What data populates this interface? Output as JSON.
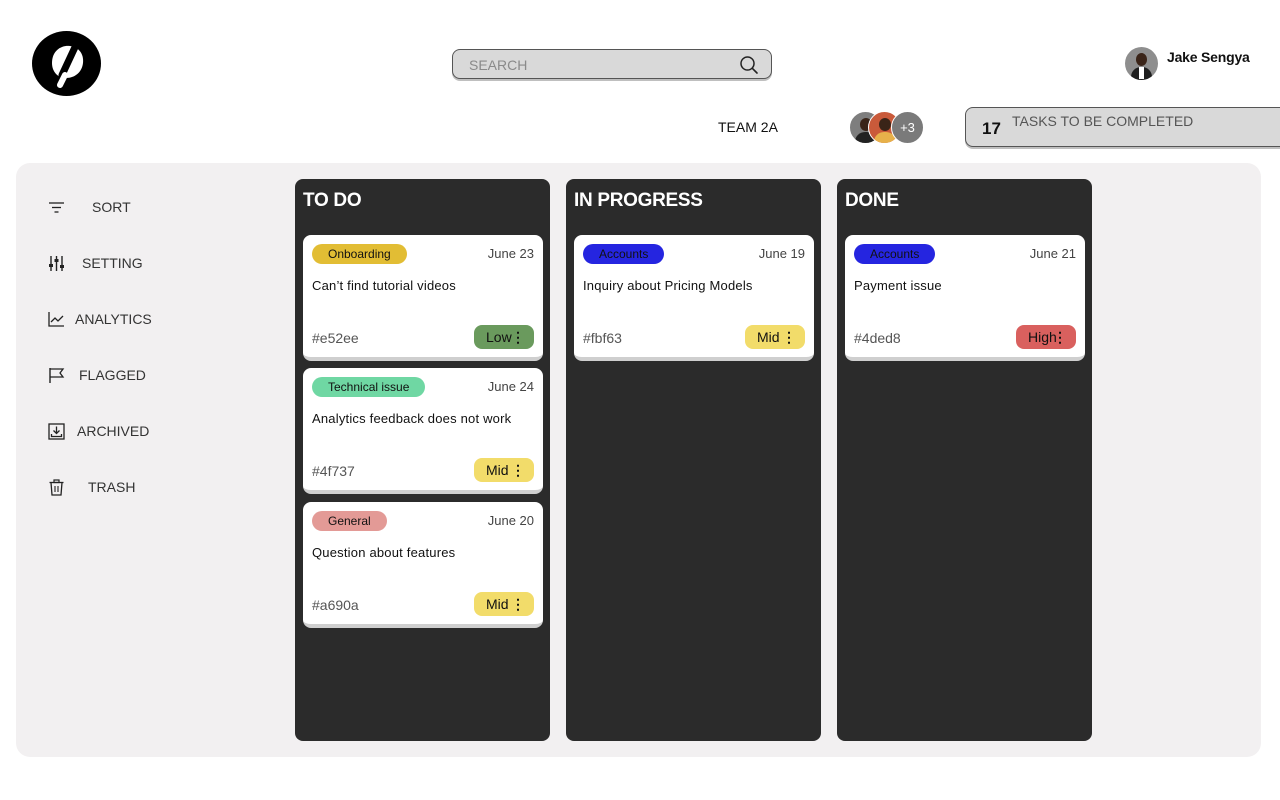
{
  "header": {
    "search_placeholder": "SEARCH",
    "user_name": "Jake Sengya"
  },
  "team": {
    "label": "TEAM 2A",
    "extra_members": "+3"
  },
  "tasks": {
    "count": "17",
    "label": "TASKS TO BE COMPLETED"
  },
  "menu": [
    {
      "label": "SORT",
      "icon": "sort-icon"
    },
    {
      "label": "SETTING",
      "icon": "sliders-icon"
    },
    {
      "label": "ANALYTICS",
      "icon": "line-chart-icon"
    },
    {
      "label": "FLAGGED",
      "icon": "flag-icon"
    },
    {
      "label": "ARCHIVED",
      "icon": "archive-download-icon"
    },
    {
      "label": "TRASH",
      "icon": "trash-icon"
    }
  ],
  "colors": {
    "onboarding": "#e2bd34",
    "technical": "#6fd7a3",
    "general": "#e39a96",
    "accounts": "#2525e0",
    "low": "#6a9a5d",
    "mid": "#f2dc6a",
    "high": "#d9605e"
  },
  "columns": [
    {
      "title": "TO DO",
      "cards": [
        {
          "tag": "Onboarding",
          "date": "June 23",
          "title": "Can’t find tutorial videos",
          "id": "#e52ee",
          "priority": "Low"
        },
        {
          "tag": "Technical issue",
          "date": "June 24",
          "title": "Analytics feedback does not work",
          "id": "#4f737",
          "priority": "Mid"
        },
        {
          "tag": "General",
          "date": "June 20",
          "title": "Question about features",
          "id": "#a690a",
          "priority": "Mid"
        }
      ]
    },
    {
      "title": "IN PROGRESS",
      "cards": [
        {
          "tag": "Accounts",
          "date": "June 19",
          "title": "Inquiry about Pricing Models",
          "id": "#fbf63",
          "priority": "Mid"
        }
      ]
    },
    {
      "title": "DONE",
      "cards": [
        {
          "tag": "Accounts",
          "date": "June 21",
          "title": "Payment issue",
          "id": "#4ded8",
          "priority": "High"
        }
      ]
    }
  ]
}
